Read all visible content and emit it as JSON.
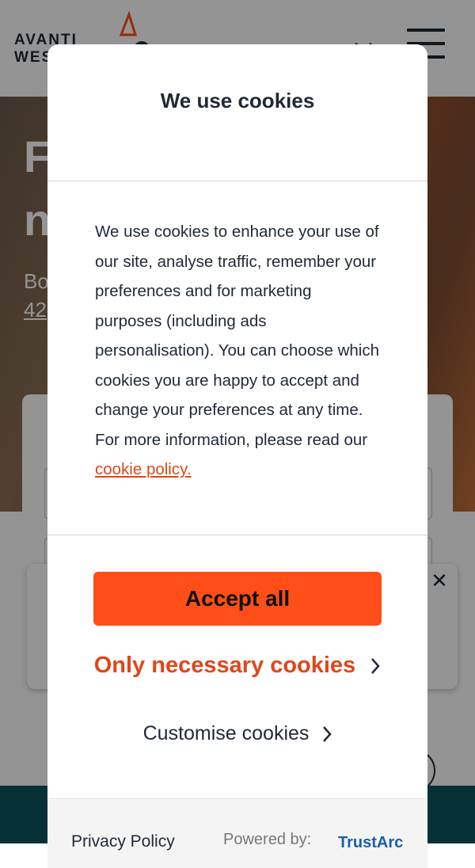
{
  "brand": {
    "logo_line1": "AVANTI",
    "logo_line2": "WEST COAST",
    "accent_color": "#ff4e17"
  },
  "hero": {
    "title_line1": "F",
    "title_line2": "n",
    "text_line1": "Bo",
    "text_link": "42"
  },
  "cookie_modal": {
    "title": "We use cookies",
    "body": "We use cookies to enhance your use of our site, analyse traffic, remember your preferences and for marketing purposes (including ads personalisation). You can choose which cookies you are happy to accept and change your preferences at any time. For more information, please read our",
    "policy_link": "cookie policy.",
    "accept_label": "Accept all",
    "necessary_label": "Only necessary cookies",
    "customise_label": "Customise cookies",
    "privacy_policy_label": "Privacy Policy",
    "powered_by_label": "Powered by:",
    "trustarc_label": "TrustArc"
  },
  "icons": {
    "menu": "hamburger-icon",
    "close": "close-icon",
    "chevron": "chevron-right-icon"
  },
  "colors": {
    "link_orange": "#e0461a",
    "footer_teal": "#0b5660"
  }
}
